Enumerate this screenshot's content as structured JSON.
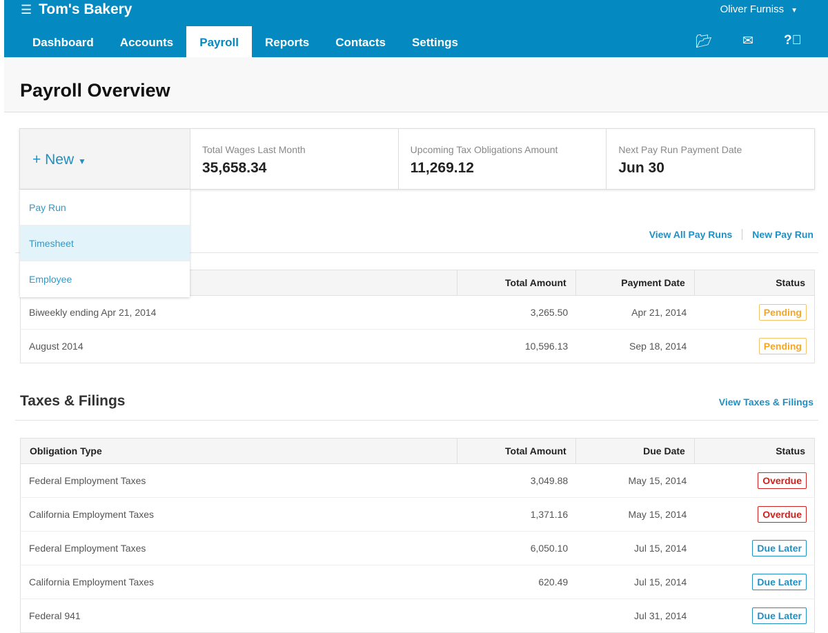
{
  "app": {
    "title": "Tom's Bakery",
    "user": "Oliver Furniss"
  },
  "nav": [
    {
      "label": "Dashboard"
    },
    {
      "label": "Accounts"
    },
    {
      "label": "Payroll",
      "active": true
    },
    {
      "label": "Reports"
    },
    {
      "label": "Contacts"
    },
    {
      "label": "Settings"
    }
  ],
  "icons": [
    "folder-icon",
    "mail-icon",
    "help-icon"
  ],
  "page": {
    "title": "Payroll Overview"
  },
  "summary": {
    "new_label": "+ New",
    "stats": [
      {
        "label": "Total Wages Last Month",
        "value": "35,658.34"
      },
      {
        "label": "Upcoming Tax Obligations Amount",
        "value": "11,269.12"
      },
      {
        "label": "Next Pay Run Payment Date",
        "value": "Jun 30"
      }
    ]
  },
  "new_menu": [
    {
      "label": "Pay Run"
    },
    {
      "label": "Timesheet",
      "highlighted": true
    },
    {
      "label": "Employee"
    }
  ],
  "payruns": {
    "links": [
      "View All Pay Runs",
      "New Pay Run"
    ],
    "columns": [
      "",
      "Total Amount",
      "Payment Date",
      "Status"
    ],
    "rows": [
      [
        "Biweekly ending Apr 21, 2014",
        "3,265.50",
        "Apr 21, 2014",
        "Pending"
      ],
      [
        "August 2014",
        "10,596.13",
        "Sep 18, 2014",
        "Pending"
      ]
    ]
  },
  "taxes": {
    "title": "Taxes & Filings",
    "link": "View Taxes & Filings",
    "columns": [
      "Obligation Type",
      "Total Amount",
      "Due Date",
      "Status"
    ],
    "rows": [
      [
        "Federal Employment Taxes",
        "3,049.88",
        "May 15, 2014",
        "Overdue"
      ],
      [
        "California Employment Taxes",
        "1,371.16",
        "May 15, 2014",
        "Overdue"
      ],
      [
        "Federal Employment Taxes",
        "6,050.10",
        "Jul 15, 2014",
        "Due Later"
      ],
      [
        "California Employment Taxes",
        "620.49",
        "Jul 15, 2014",
        "Due Later"
      ],
      [
        "Federal 941",
        "",
        "Jul 31, 2014",
        "Due Later"
      ]
    ]
  },
  "colors": {
    "brand": "#0589c1",
    "pending": "#f5a623",
    "overdue": "#d0211c",
    "due_later": "#1f8fc4"
  }
}
